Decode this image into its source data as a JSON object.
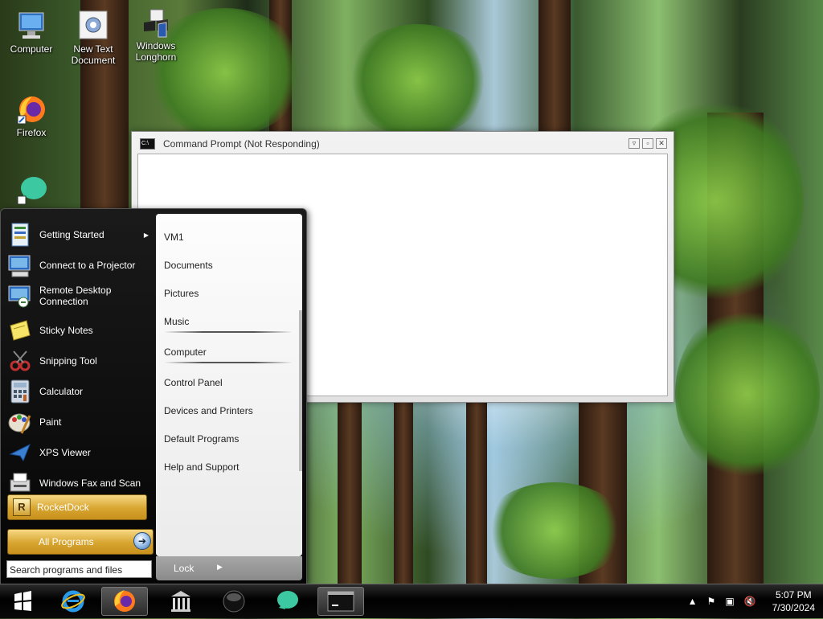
{
  "desktop": {
    "icons": [
      {
        "label": "Computer"
      },
      {
        "label": "New Text Document"
      },
      {
        "label": "Windows Longhorn"
      },
      {
        "label": "Firefox"
      },
      {
        "label": ""
      }
    ]
  },
  "cmd_window": {
    "title": "Command Prompt (Not Responding)",
    "icon_text": "C:\\"
  },
  "start_menu": {
    "programs": [
      {
        "label": "Getting Started",
        "has_arrow": true
      },
      {
        "label": "Connect to a Projector"
      },
      {
        "label": "Remote Desktop Connection"
      },
      {
        "label": "Sticky Notes"
      },
      {
        "label": "Snipping Tool"
      },
      {
        "label": "Calculator"
      },
      {
        "label": "Paint"
      },
      {
        "label": "XPS Viewer"
      },
      {
        "label": "Windows Fax and Scan"
      }
    ],
    "rocketdock": "RocketDock",
    "all_programs": "All Programs",
    "search_placeholder": "Search programs and files",
    "places": [
      "VM1",
      "Documents",
      "Pictures",
      "Music",
      "Computer",
      "Control Panel",
      "Devices and Printers",
      "Default Programs",
      "Help and Support"
    ],
    "lock_label": "Lock"
  },
  "taskbar": {
    "pinned": [
      "start-orb",
      "internet-explorer-icon",
      "firefox-icon",
      "library-icon",
      "dark-orb-icon",
      "chat-bubble-icon",
      "command-prompt-icon"
    ],
    "clock_time": "5:07 PM",
    "clock_date": "7/30/2024"
  }
}
